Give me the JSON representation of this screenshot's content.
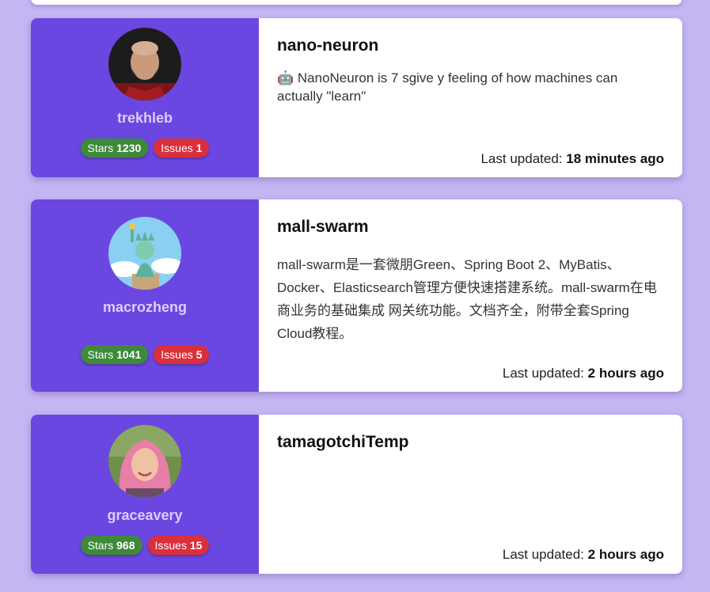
{
  "cards": [
    {
      "username": "trekhleb",
      "stars_label": "Stars",
      "stars": "1230",
      "issues_label": "Issues",
      "issues": "1",
      "repo": "nano-neuron",
      "description": "🤖 NanoNeuron is 7 sgive y feeling of how machines can actually \"learn\"",
      "updated_label": "Last updated:",
      "updated_value": "18 minutes ago"
    },
    {
      "username": "macrozheng",
      "stars_label": "Stars",
      "stars": "1041",
      "issues_label": "Issues",
      "issues": "5",
      "repo": "mall-swarm",
      "description": "mall-swarm是一套微朋Green、Spring Boot 2、MyBatis、Docker、Elasticsearch管理方便快速搭建系统。mall-swarm在电商业务的基础集成 网关统功能。文档齐全，附带全套Spring Cloud教程。",
      "updated_label": "Last updated:",
      "updated_value": "2 hours ago"
    },
    {
      "username": "graceavery",
      "stars_label": "Stars",
      "stars": "968",
      "issues_label": "Issues",
      "issues": "15",
      "repo": "tamagotchiTemp",
      "description": "",
      "updated_label": "Last updated:",
      "updated_value": "2 hours ago"
    }
  ]
}
